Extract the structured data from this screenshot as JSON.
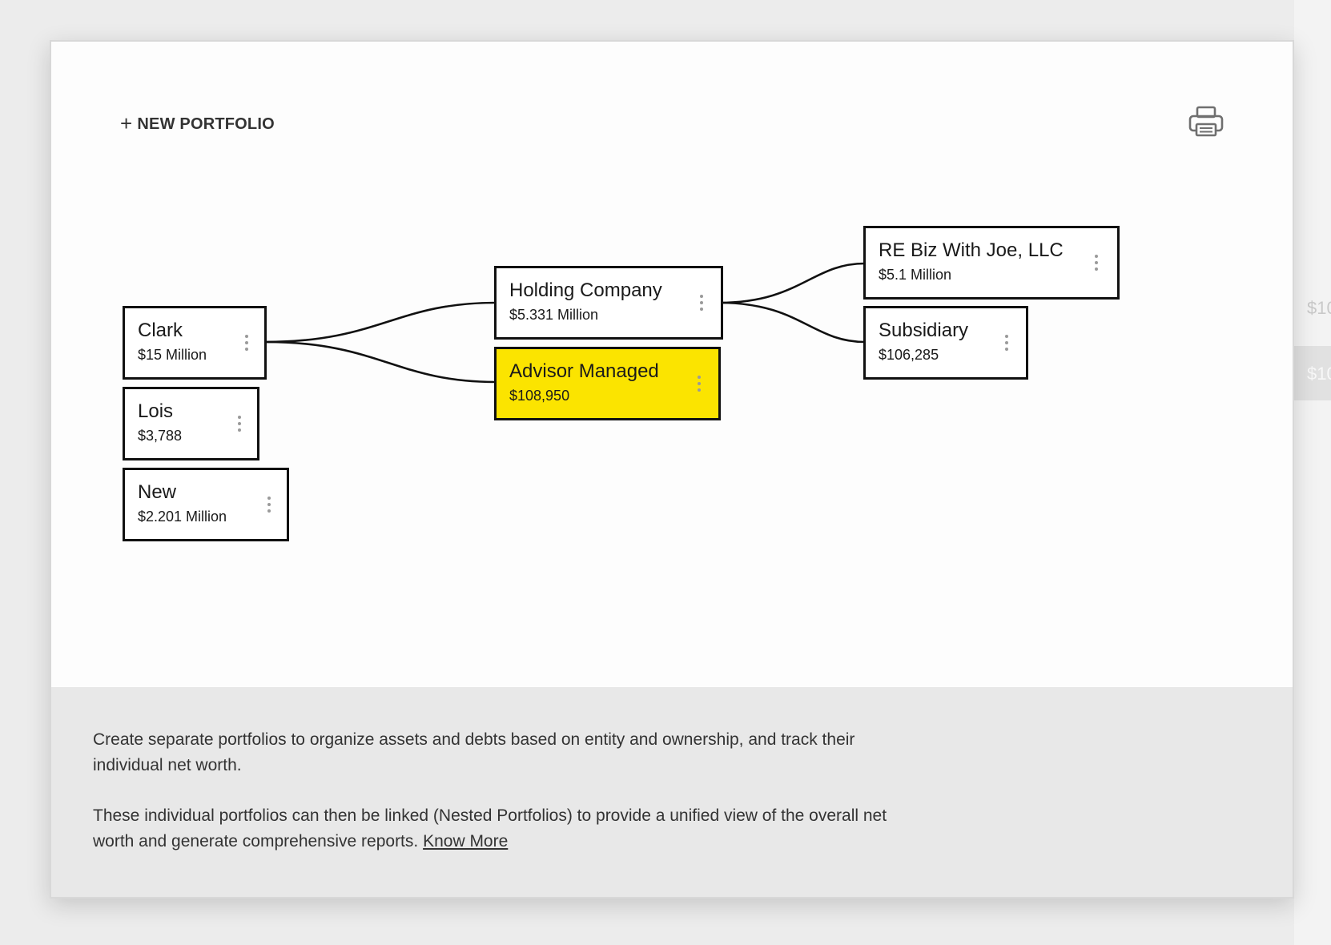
{
  "toolbar": {
    "new_portfolio_icon": "plus-icon",
    "new_portfolio_label": "NEW PORTFOLIO",
    "print_icon": "printer-icon"
  },
  "backdrop": {
    "ghost_value_1": "$10",
    "ghost_value_2": "$10"
  },
  "tree": {
    "nodes": [
      {
        "id": "clark",
        "name": "Clark",
        "value": "$15 Million",
        "highlighted": false,
        "parent": null
      },
      {
        "id": "lois",
        "name": "Lois",
        "value": "$3,788",
        "highlighted": false,
        "parent": null
      },
      {
        "id": "new",
        "name": "New",
        "value": "$2.201 Million",
        "highlighted": false,
        "parent": null
      },
      {
        "id": "holding",
        "name": "Holding Company",
        "value": "$5.331 Million",
        "highlighted": false,
        "parent": "clark"
      },
      {
        "id": "advisor",
        "name": "Advisor Managed",
        "value": "$108,950",
        "highlighted": true,
        "parent": "clark"
      },
      {
        "id": "rebiz",
        "name": "RE Biz With Joe, LLC",
        "value": "$5.1 Million",
        "highlighted": false,
        "parent": "holding"
      },
      {
        "id": "subsidiary",
        "name": "Subsidiary",
        "value": "$106,285",
        "highlighted": false,
        "parent": "holding"
      }
    ],
    "menu_icon": "kebab-menu-icon",
    "highlight_color": "#fbe400"
  },
  "info": {
    "paragraph_1": "Create separate portfolios to organize assets and debts based on entity and ownership, and track their individual net worth.",
    "paragraph_2": "These individual portfolios can then be linked (Nested Portfolios) to provide a unified view of the overall net worth and generate comprehensive reports.",
    "know_more_label": "Know More"
  }
}
